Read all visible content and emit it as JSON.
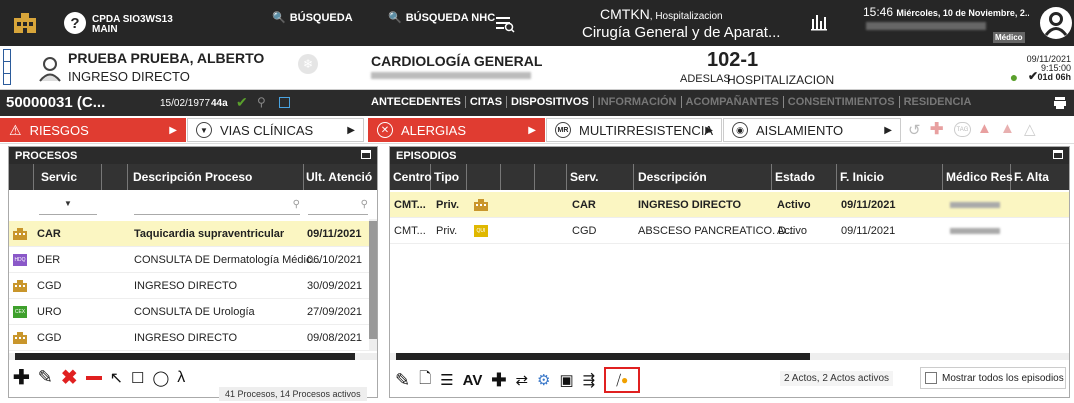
{
  "topbar": {
    "user_line1": "CPDA SIO3WS13",
    "user_line2": "MAIN",
    "search_label": "BÚSQUEDA",
    "search_nhc_label": "BÚSQUEDA NHC",
    "center_line1": "CMTKN",
    "center_line1_suffix": ", Hospitalizacion",
    "center_line2": "Cirugía General y de Aparat...",
    "time": "15:46",
    "date": "Miércoles, 10 de Noviembre, 2...",
    "role": "Médico"
  },
  "patient": {
    "name": "PRUEBA PRUEBA, ALBERTO",
    "admission": "INGRESO DIRECTO",
    "service": "CARDIOLOGÍA GENERAL",
    "room": "102-1",
    "insurer": "ADESLAS",
    "episode_type": "HOSPITALIZACION",
    "date": "09/11/2021",
    "time": "9:15:00",
    "duration": "01d 06h"
  },
  "strip": {
    "id": "50000031 (C...",
    "dob": "15/02/1977",
    "age": "44a",
    "tabs": [
      "ANTECEDENTES",
      "CITAS",
      "DISPOSITIVOS",
      "INFORMACIÓN",
      "ACOMPAÑANTES",
      "CONSENTIMIENTOS",
      "RESIDENCIA"
    ]
  },
  "alerts": {
    "riesgos": "RIESGOS",
    "vias": "VIAS CLÍNICAS",
    "alergias": "ALERGIAS",
    "multi": "MULTIRRESISTENCIA",
    "aislamiento": "AISLAMIENTO",
    "mr_badge": "MR",
    "tag_badge": "TAG"
  },
  "procesos": {
    "title": "PROCESOS",
    "headers": [
      "Servic",
      "Descripción Proceso",
      "Ult. Atenció"
    ],
    "rows": [
      {
        "serv": "CAR",
        "desc": "Taquicardia supraventricular",
        "date": "09/11/2021",
        "icon": "hospital-icon",
        "bold": true
      },
      {
        "serv": "DER",
        "desc": "CONSULTA DE Dermatología Médic...",
        "date": "06/10/2021",
        "icon": "consult-icon",
        "bold": false
      },
      {
        "serv": "CGD",
        "desc": "INGRESO DIRECTO",
        "date": "30/09/2021",
        "icon": "hospital-icon",
        "bold": false
      },
      {
        "serv": "URO",
        "desc": "CONSULTA DE Urología",
        "date": "27/09/2021",
        "icon": "cex-icon",
        "bold": false
      },
      {
        "serv": "CGD",
        "desc": "INGRESO DIRECTO",
        "date": "09/08/2021",
        "icon": "hospital-icon",
        "bold": false
      }
    ],
    "footer": "41 Procesos, 14 Procesos activos",
    "hdq": "HDQ",
    "cex": "CEX"
  },
  "episodios": {
    "title": "EPISODIOS",
    "headers": [
      "Centro",
      "Tipo",
      "Serv.",
      "Descripción",
      "Estado",
      "F. Inicio",
      "Médico Res",
      "F. Alta"
    ],
    "rows": [
      {
        "centro": "CMT...",
        "tipo": "Priv.",
        "serv": "CAR",
        "desc": "INGRESO DIRECTO",
        "estado": "Activo",
        "inicio": "09/11/2021",
        "bold": true
      },
      {
        "centro": "CMT...",
        "tipo": "Priv.",
        "serv": "CGD",
        "desc": "ABSCESO PANCREATICO. D...",
        "estado": "Activo",
        "inicio": "09/11/2021",
        "bold": false
      }
    ],
    "qui": "QUI",
    "status": "2 Actos, 2 Actos activos",
    "show_all": "Mostrar todos los episodios",
    "av_label": "AV"
  },
  "colors": {
    "accent_red": "#e03c31",
    "dark": "#262626",
    "highlight": "#fbf6c2",
    "green": "#5aa02c"
  }
}
